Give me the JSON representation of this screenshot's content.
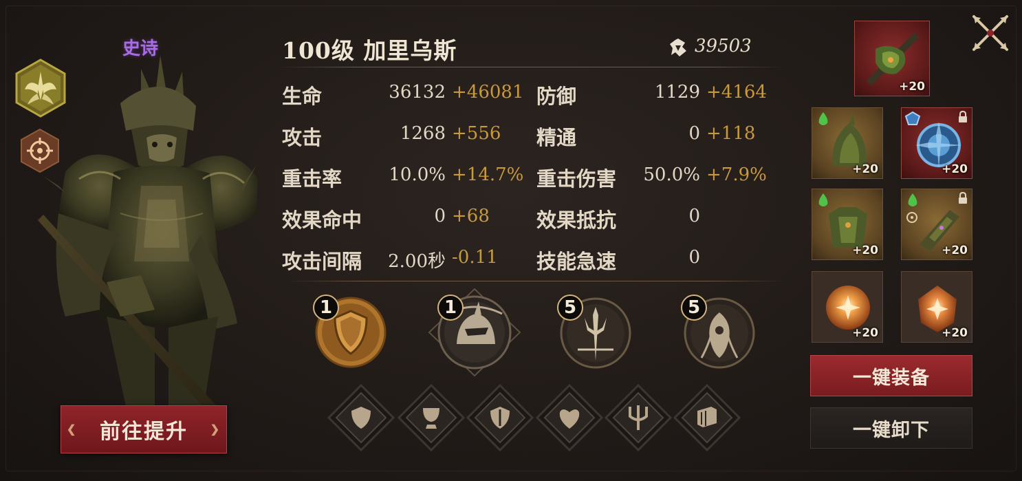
{
  "hero": {
    "rarity": "史诗",
    "title": "100级  加里乌斯",
    "power": "39503",
    "class_icon": "wing-emblem-icon",
    "element_icon": "compass-wheel-icon"
  },
  "stats": [
    {
      "label": "生命",
      "base": "36132",
      "bonus": "+46081"
    },
    {
      "label": "防御",
      "base": "1129",
      "bonus": "+4164"
    },
    {
      "label": "攻击",
      "base": "1268",
      "bonus": "+556"
    },
    {
      "label": "精通",
      "base": "0",
      "bonus": "+118"
    },
    {
      "label": "重击率",
      "base": "10.0%",
      "bonus": "+14.7%"
    },
    {
      "label": "重击伤害",
      "base": "50.0%",
      "bonus": "+7.9%"
    },
    {
      "label": "效果命中",
      "base": "0",
      "bonus": "+68"
    },
    {
      "label": "效果抵抗",
      "base": "0",
      "bonus": ""
    },
    {
      "label": "攻击间隔",
      "base": "2.00秒",
      "bonus": "-0.11"
    },
    {
      "label": "技能急速",
      "base": "0",
      "bonus": ""
    }
  ],
  "skills": [
    {
      "level": "1",
      "icon": "shield-skill-icon"
    },
    {
      "level": "1",
      "icon": "helmet-skill-icon"
    },
    {
      "level": "5",
      "icon": "trident-skill-icon"
    },
    {
      "level": "5",
      "icon": "spirit-skill-icon"
    }
  ],
  "runes": [
    "shield-rune-icon",
    "chalice-rune-icon",
    "shield-rune-icon",
    "heart-rune-icon",
    "trident-rune-icon",
    "armor-rune-icon"
  ],
  "equipment": [
    {
      "name": "weapon",
      "enhance": "+20",
      "icon": "mossy-weapon-icon"
    },
    {
      "name": "helmet",
      "enhance": "+20",
      "icon": "mossy-helmet-icon"
    },
    {
      "name": "shield",
      "enhance": "+20",
      "icon": "frost-shield-icon"
    },
    {
      "name": "armor",
      "enhance": "+20",
      "icon": "mossy-armor-icon"
    },
    {
      "name": "gloves",
      "enhance": "+20",
      "icon": "mossy-gloves-icon"
    },
    {
      "name": "ring",
      "enhance": "+20",
      "icon": "amber-ring-icon"
    },
    {
      "name": "amulet",
      "enhance": "+20",
      "icon": "amber-amulet-icon"
    }
  ],
  "buttons": {
    "go_upgrade": "前往提升",
    "equip_all": "一键装备",
    "unequip_all": "一键卸下"
  },
  "colors": {
    "rarity": "#a86de6",
    "bonus": "#c99a3c",
    "primary_button": "#8a2429"
  }
}
